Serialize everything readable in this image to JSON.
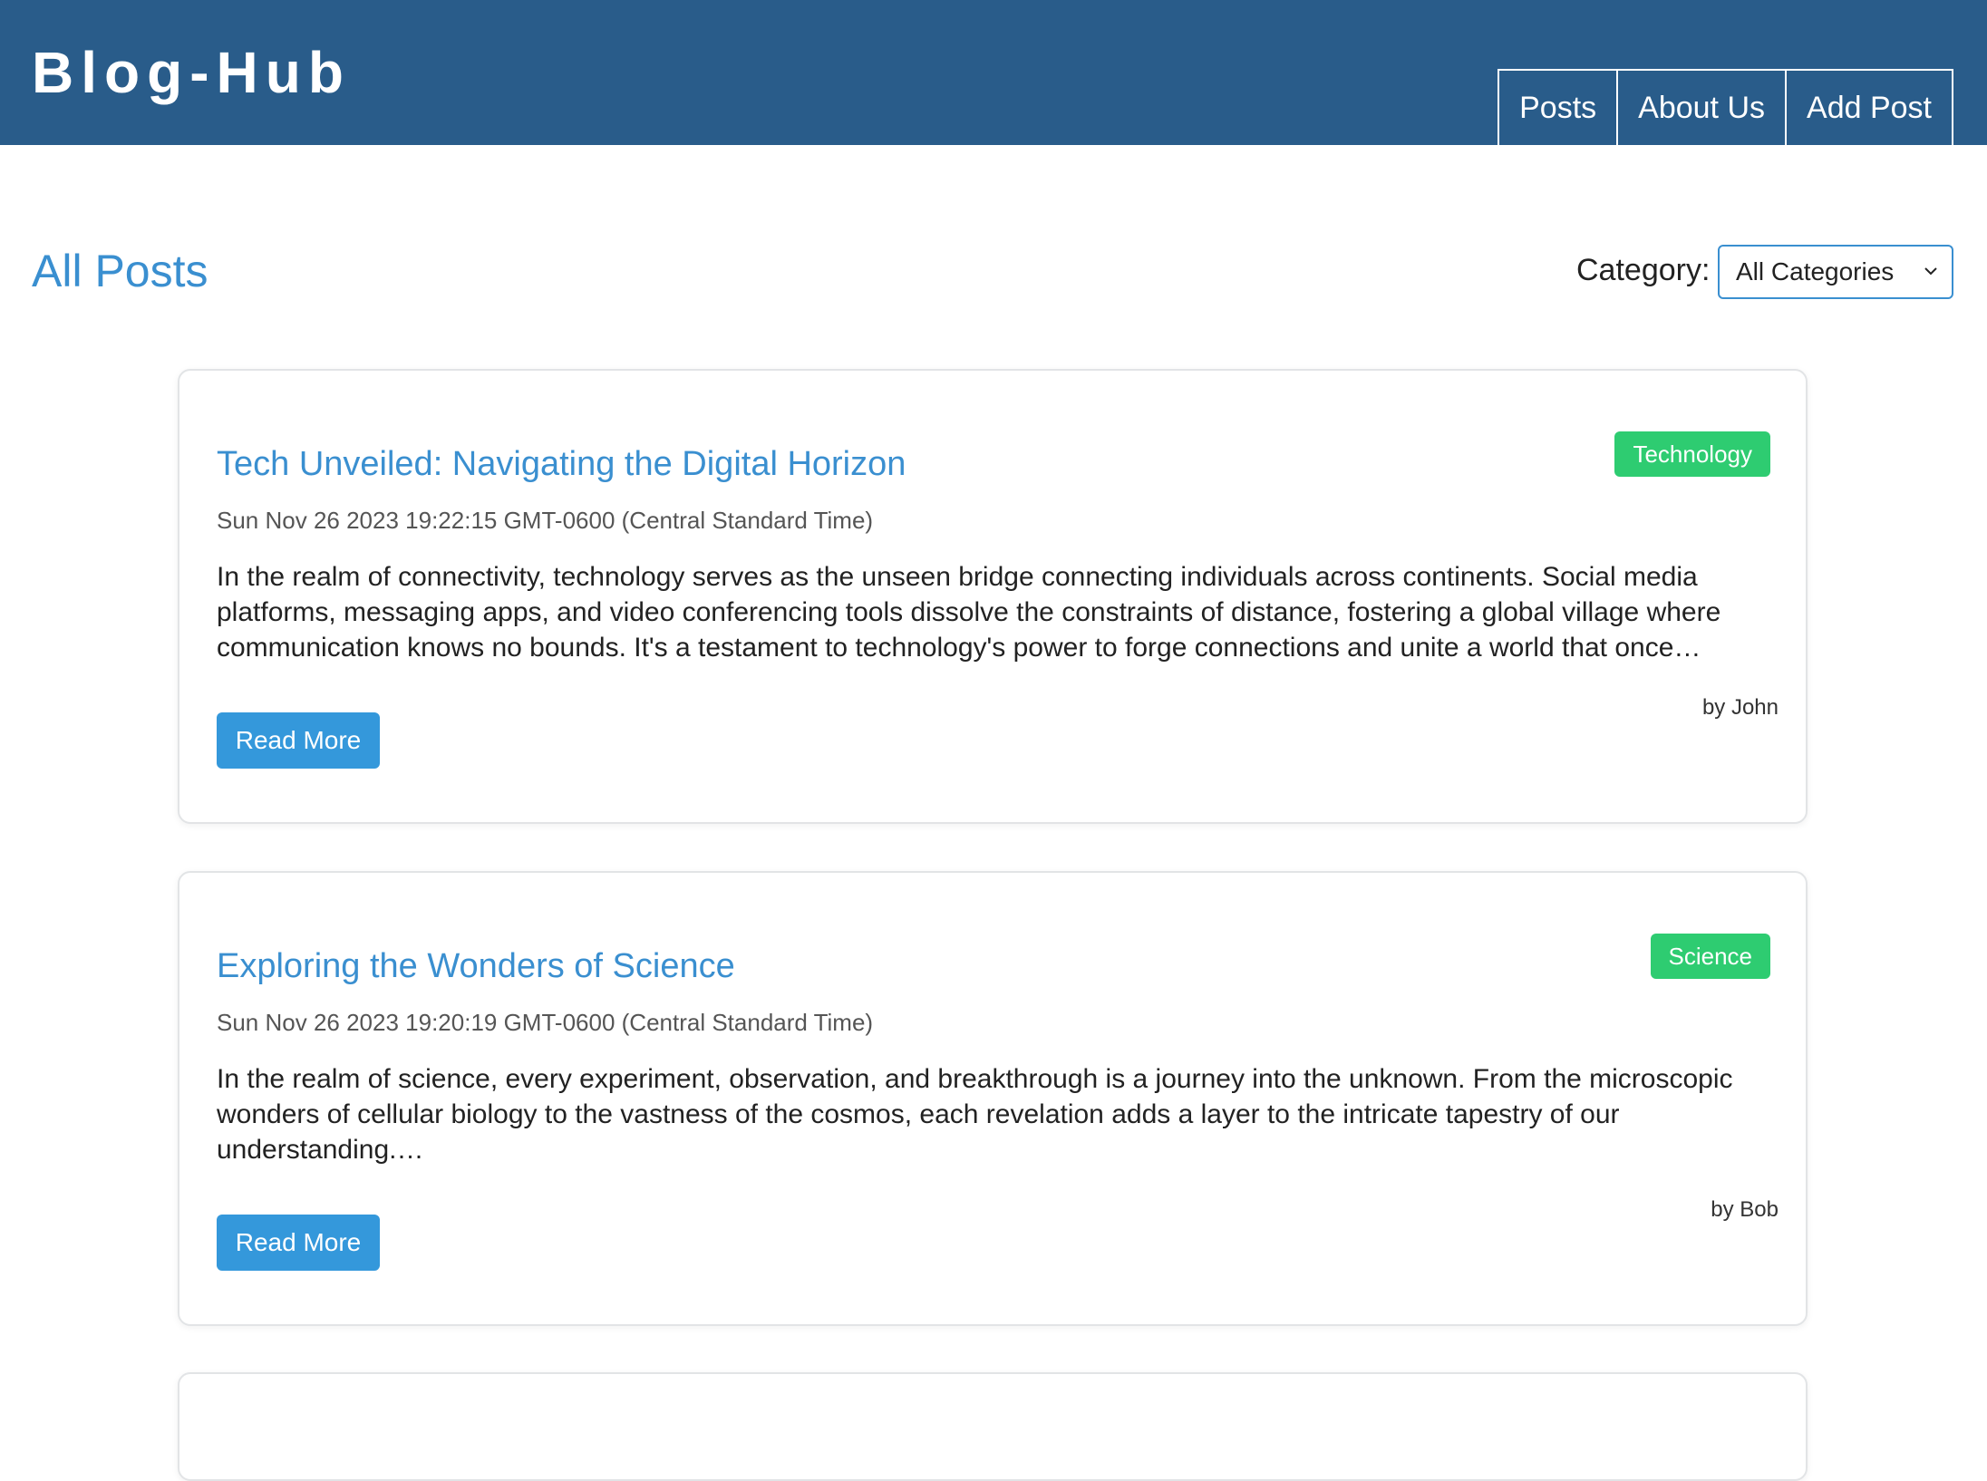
{
  "header": {
    "brand": "Blog-Hub",
    "nav": [
      {
        "label": "Posts"
      },
      {
        "label": "About Us"
      },
      {
        "label": "Add Post"
      }
    ]
  },
  "main": {
    "title": "All Posts",
    "category_label": "Category:",
    "category_selected": "All Categories"
  },
  "posts": [
    {
      "title": "Tech Unveiled: Navigating the Digital Horizon",
      "category": "Technology",
      "date": "Sun Nov 26 2023 19:22:15 GMT-0600 (Central Standard Time)",
      "excerpt": "In the realm of connectivity, technology serves as the unseen bridge connecting individuals across continents. Social media platforms, messaging apps, and video conferencing tools dissolve the constraints of distance, fostering a global village where communication knows no bounds. It's a testament to technology's power to forge connections and unite a world that once…",
      "author": "by John",
      "button": "Read More"
    },
    {
      "title": "Exploring the Wonders of Science",
      "category": "Science",
      "date": "Sun Nov 26 2023 19:20:19 GMT-0600 (Central Standard Time)",
      "excerpt": "In the realm of science, every experiment, observation, and breakthrough is a journey into the unknown. From the microscopic wonders of cellular biology to the vastness of the cosmos, each revelation adds a layer to the intricate tapestry of our understanding.…",
      "author": "by Bob",
      "button": "Read More"
    }
  ],
  "colors": {
    "header_bg": "#295c8a",
    "accent": "#3a8fd0",
    "badge": "#2ecc71",
    "button": "#3498db"
  },
  "icons": {
    "select_caret": "chevron-down-icon"
  }
}
